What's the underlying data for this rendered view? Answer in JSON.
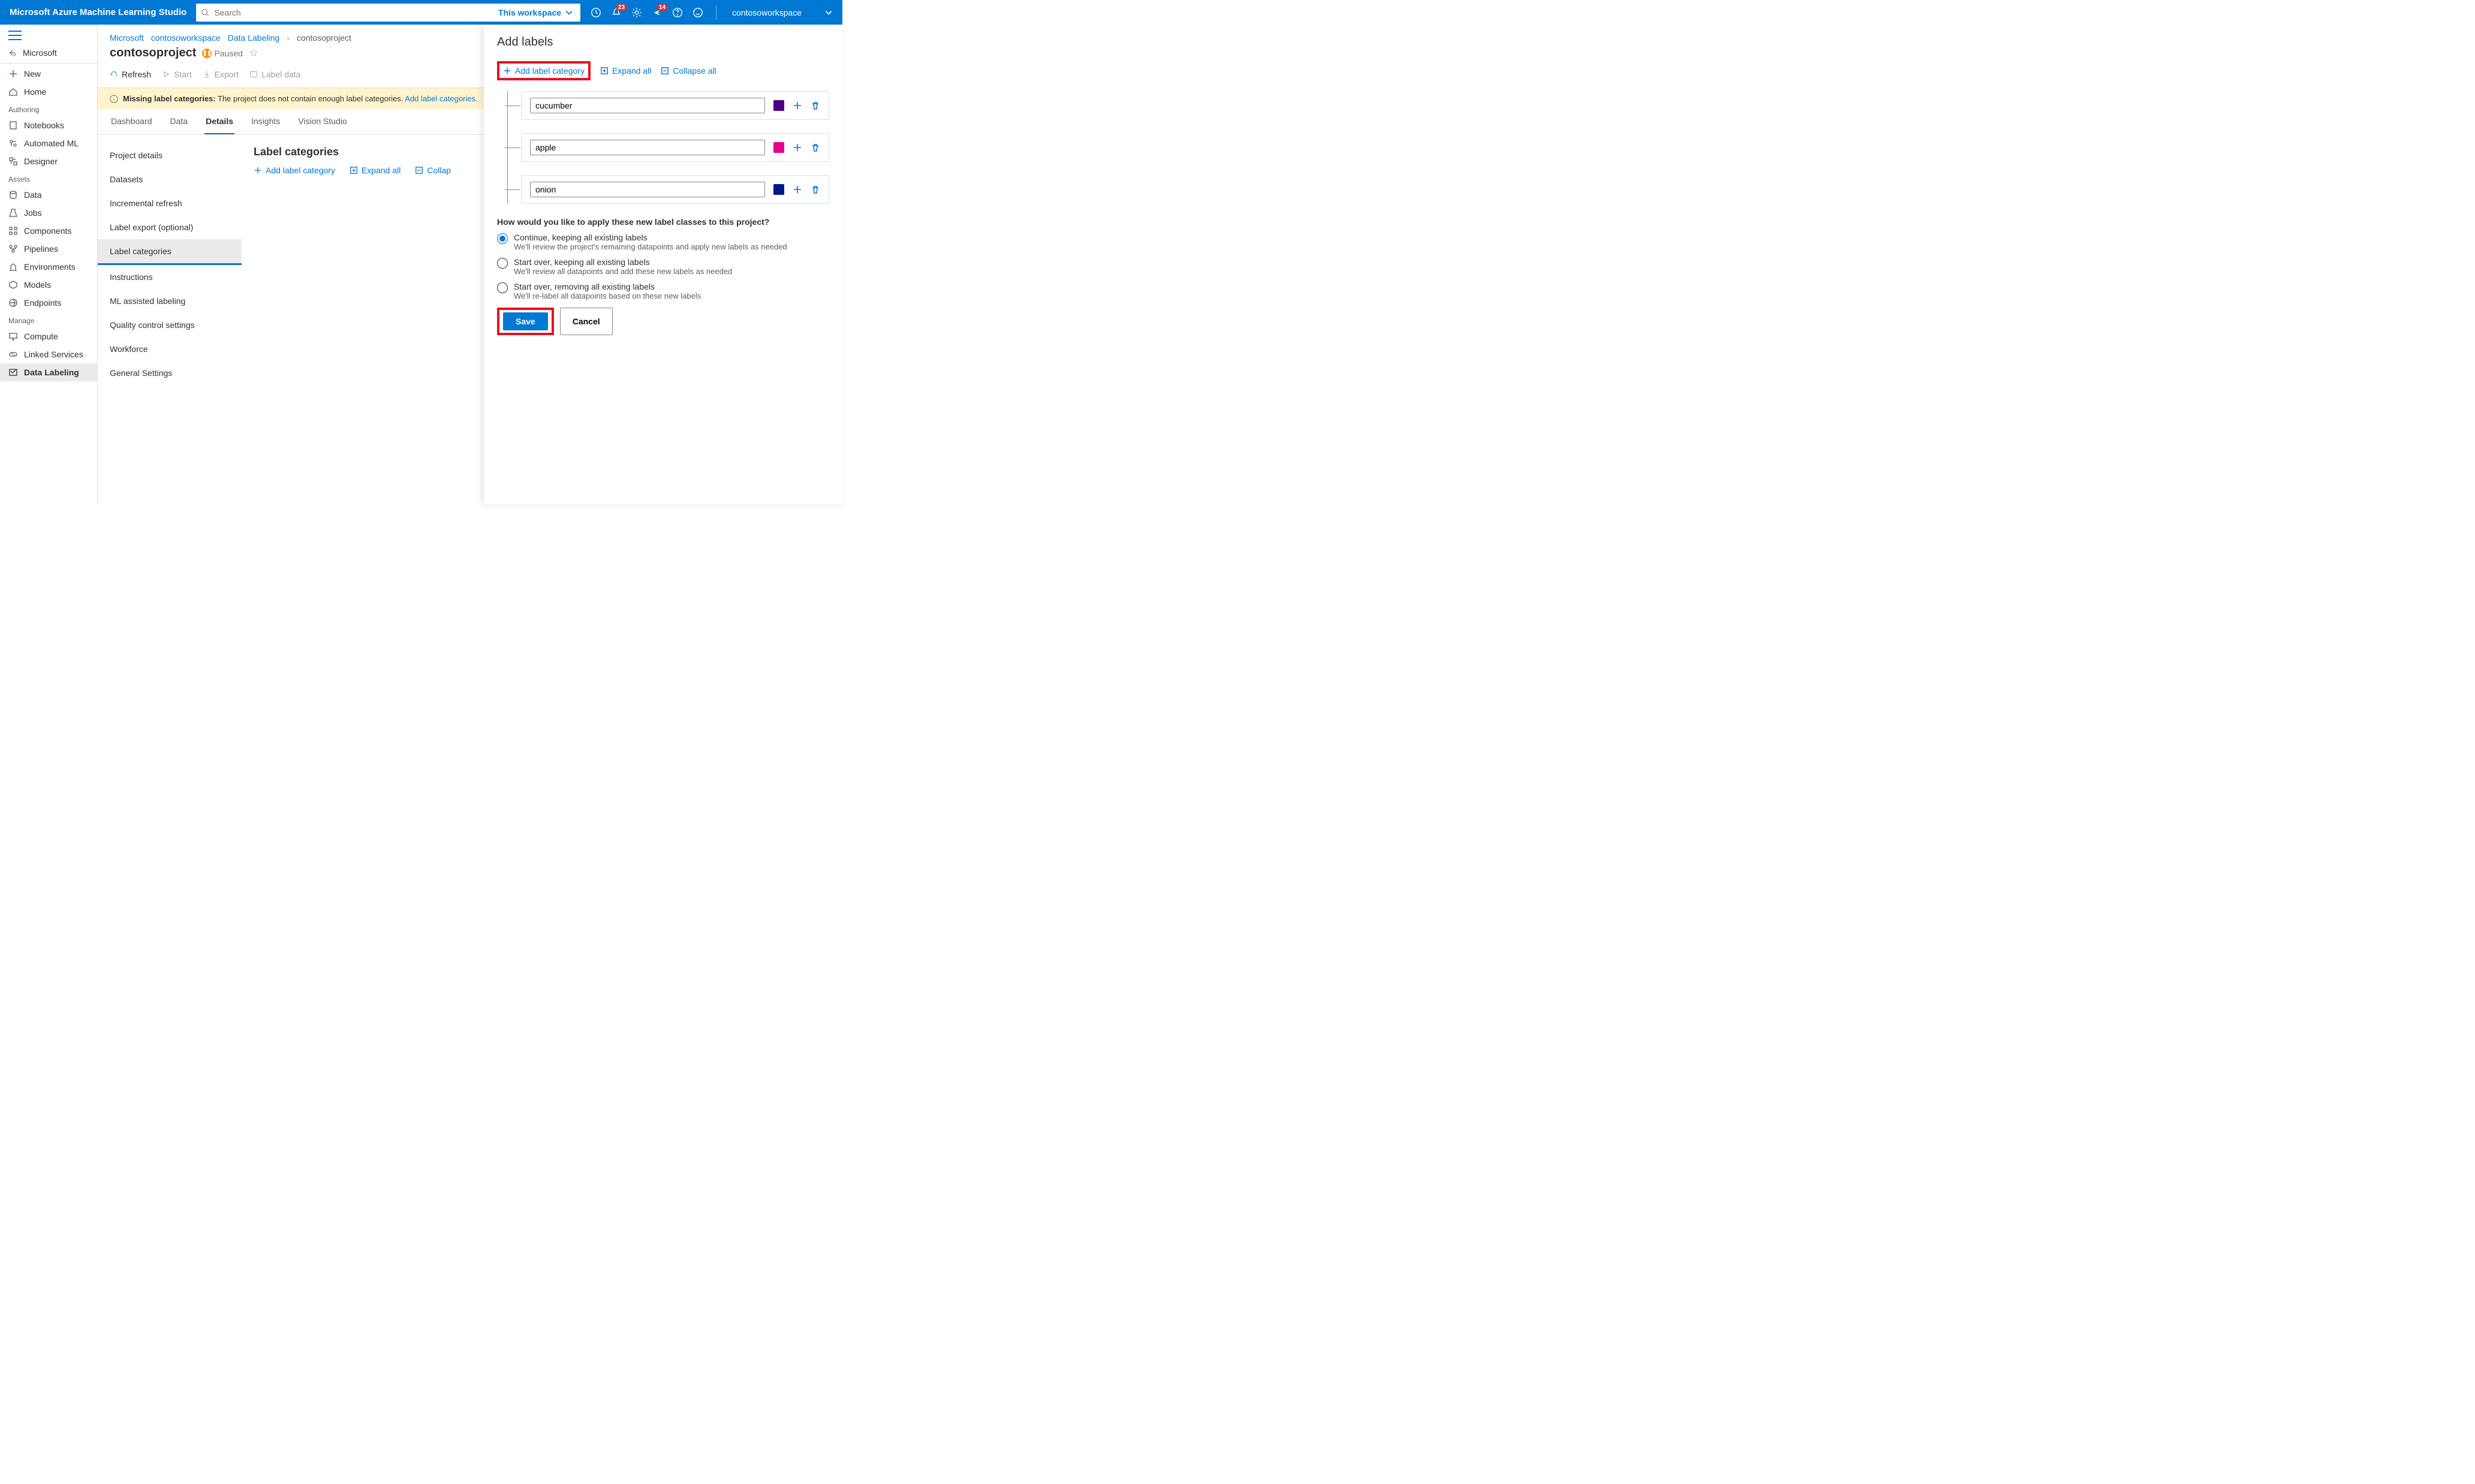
{
  "topbar": {
    "brand": "Microsoft Azure Machine Learning Studio",
    "search_placeholder": "Search",
    "scope": "This workspace",
    "badges": {
      "bell": "23",
      "share": "14"
    },
    "workspace": "contosoworkspace"
  },
  "nav": {
    "back": "Microsoft",
    "new": "New",
    "home": "Home",
    "sections": {
      "authoring": "Authoring",
      "assets": "Assets",
      "manage": "Manage"
    },
    "items": {
      "notebooks": "Notebooks",
      "automl": "Automated ML",
      "designer": "Designer",
      "data": "Data",
      "jobs": "Jobs",
      "components": "Components",
      "pipelines": "Pipelines",
      "environments": "Environments",
      "models": "Models",
      "endpoints": "Endpoints",
      "compute": "Compute",
      "linked": "Linked Services",
      "labeling": "Data Labeling"
    }
  },
  "breadcrumb": {
    "a": "Microsoft",
    "b": "contosoworkspace",
    "c": "Data Labeling",
    "d": "contosoproject"
  },
  "project": {
    "name": "contosoproject",
    "status": "Paused"
  },
  "actions": {
    "refresh": "Refresh",
    "start": "Start",
    "export": "Export",
    "labeldata": "Label data"
  },
  "warning": {
    "prefix": "Missing label categories:",
    "text": "The project does not contain enough label categories.",
    "link": "Add label categories."
  },
  "tabs": {
    "dashboard": "Dashboard",
    "data": "Data",
    "details": "Details",
    "insights": "Insights",
    "vision": "Vision Studio"
  },
  "sidemenu": {
    "project_details": "Project details",
    "datasets": "Datasets",
    "incremental": "Incremental refresh",
    "export": "Label export (optional)",
    "categories": "Label categories",
    "instructions": "Instructions",
    "ml": "ML assisted labeling",
    "quality": "Quality control settings",
    "workforce": "Workforce",
    "general": "General Settings"
  },
  "content": {
    "title": "Label categories",
    "add": "Add label category",
    "expand": "Expand all",
    "collapse": "Collap"
  },
  "panel": {
    "title": "Add labels",
    "add": "Add label category",
    "expand": "Expand all",
    "collapse": "Collapse all",
    "labels": [
      {
        "name": "cucumber",
        "color": "#4b0082"
      },
      {
        "name": "apple",
        "color": "#e3008c"
      },
      {
        "name": "onion",
        "color": "#00188f"
      }
    ],
    "question": "How would you like to apply these new label classes to this project?",
    "options": [
      {
        "title": "Continue, keeping all existing labels",
        "sub": "We'll review the project's remaining datapoints and apply new labels as needed",
        "checked": true
      },
      {
        "title": "Start over, keeping all existing labels",
        "sub": "We'll review all datapoints and add these new labels as needed",
        "checked": false
      },
      {
        "title": "Start over, removing all existing labels",
        "sub": "We'll re-label all datapoints based on these new labels",
        "checked": false
      }
    ],
    "save": "Save",
    "cancel": "Cancel"
  }
}
